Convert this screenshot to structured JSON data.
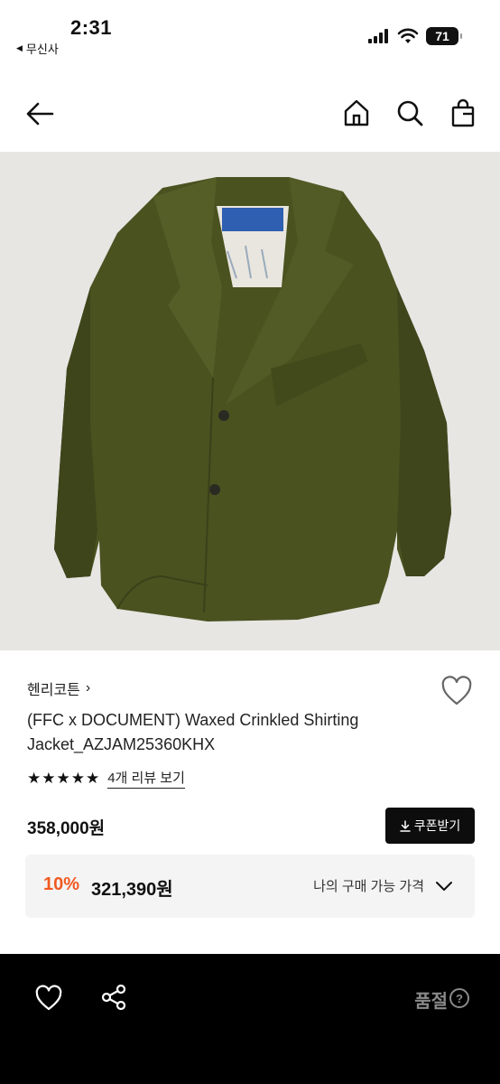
{
  "status_bar": {
    "time": "2:31",
    "back_app": "무신사",
    "battery": "71"
  },
  "icons": {
    "back": "arrow-left-icon",
    "home": "home-icon",
    "search": "search-icon",
    "bag": "shopping-bag-icon",
    "like": "heart-icon",
    "share": "share-icon",
    "help": "question-circle-icon"
  },
  "product": {
    "brand": "헨리코튼",
    "brand_chevron": "›",
    "title": "(FFC x DOCUMENT) Waxed Crinkled Shirting Jacket_AZJAM25360KHX",
    "stars": "★★★★★",
    "rating": 5,
    "review_link": "4개 리뷰 보기",
    "price": "358,000원",
    "coupon_button": "쿠폰받기"
  },
  "discount": {
    "percent": "10%",
    "price": "321,390원",
    "my_price_label": "나의 구매 가능 가격"
  },
  "bottom_bar": {
    "status": "품절",
    "help": "?"
  },
  "colors": {
    "accent_discount": "#f15a22",
    "bottom_bar": "#000000",
    "image_bg": "#e7e6e3",
    "jacket": "#4a5220"
  }
}
